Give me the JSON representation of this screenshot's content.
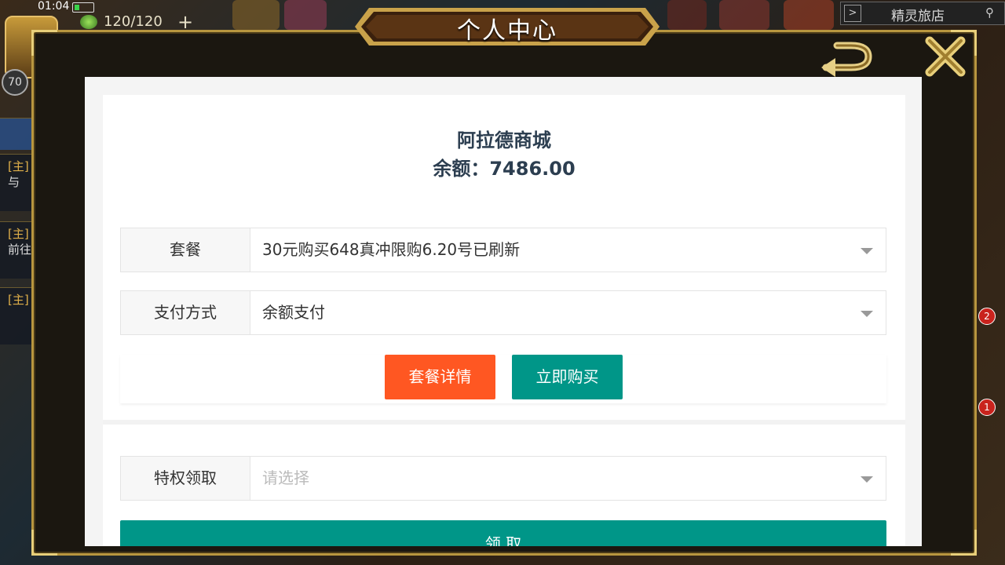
{
  "hud": {
    "time": "01:04",
    "energy": "120/120",
    "plus": "+",
    "level": "70",
    "inn_label": "精灵旅店",
    "inn_arrow": ">",
    "side_tabs": [
      {
        "tag": "[主]",
        "text": "与"
      },
      {
        "tag": "[主]",
        "text": "前往"
      },
      {
        "tag": "[主]",
        "text": ""
      }
    ],
    "badges": [
      "2",
      "1"
    ]
  },
  "modal": {
    "title": "个人中心",
    "back_icon": "back-arrow-icon",
    "close_icon": "close-x-icon",
    "colors": {
      "frame": "#b8963f",
      "title_plate": "#4a2a12",
      "accent_orange": "#ff5722",
      "accent_teal": "#009688"
    }
  },
  "shop": {
    "name": "阿拉德商城",
    "balance": "余额：7486.00"
  },
  "form": {
    "package_label": "套餐",
    "package_value": "30元购买648真冲限购6.20号已刷新",
    "payment_label": "支付方式",
    "payment_value": "余额支付",
    "details_button": "套餐详情",
    "buy_button": "立即购买",
    "privilege_label": "特权领取",
    "privilege_placeholder": "请选择",
    "claim_button": "领 取"
  }
}
